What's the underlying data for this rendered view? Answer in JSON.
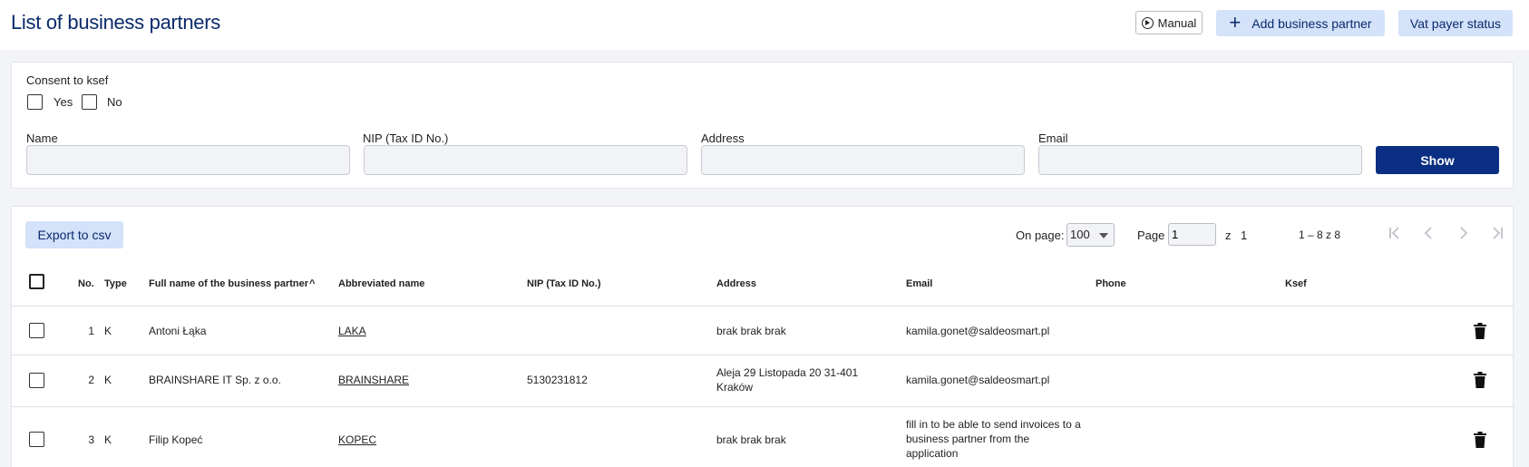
{
  "header": {
    "title": "List of business partners",
    "manual_label": "Manual",
    "add_label": "Add business partner",
    "vat_label": "Vat payer status"
  },
  "filters": {
    "consent_label": "Consent to ksef",
    "yes_label": "Yes",
    "no_label": "No",
    "name_label": "Name",
    "nip_label": "NIP (Tax ID No.)",
    "address_label": "Address",
    "email_label": "Email",
    "name_value": "",
    "nip_value": "",
    "address_value": "",
    "email_value": "",
    "show_label": "Show"
  },
  "toolbar": {
    "export_label": "Export to csv",
    "on_page_label": "On page:",
    "on_page_value": "100",
    "page_label": "Page",
    "page_value": "1",
    "of_label": "z",
    "total_pages": "1",
    "range": "1 – 8 z 8"
  },
  "table": {
    "columns": {
      "no": "No.",
      "type": "Type",
      "full_name": "Full name of the business partner",
      "abbr": "Abbreviated name",
      "nip": "NIP (Tax ID No.)",
      "address": "Address",
      "email": "Email",
      "phone": "Phone",
      "ksef": "Ksef"
    },
    "rows": [
      {
        "no": "1",
        "type": "K",
        "full_name": "Antoni Łąka",
        "abbr": "LAKA",
        "nip": "",
        "address_1": "brak brak brak",
        "address_2": "",
        "email_1": "kamila.gonet@saldeosmart.pl",
        "email_2": "",
        "email_3": "",
        "phone": "",
        "ksef": ""
      },
      {
        "no": "2",
        "type": "K",
        "full_name": "BRAINSHARE IT Sp. z o.o.",
        "abbr": "BRAINSHARE",
        "nip": "5130231812",
        "address_1": "Aleja 29 Listopada 20 31-401",
        "address_2": "Kraków",
        "email_1": "kamila.gonet@saldeosmart.pl",
        "email_2": "",
        "email_3": "",
        "phone": "",
        "ksef": ""
      },
      {
        "no": "3",
        "type": "K",
        "full_name": "Filip Kopeć",
        "abbr": "KOPEC",
        "nip": "",
        "address_1": "brak brak brak",
        "address_2": "",
        "email_1": "fill in to be able to send invoices to a",
        "email_2": "business partner from the",
        "email_3": "application",
        "phone": "",
        "ksef": ""
      }
    ]
  }
}
